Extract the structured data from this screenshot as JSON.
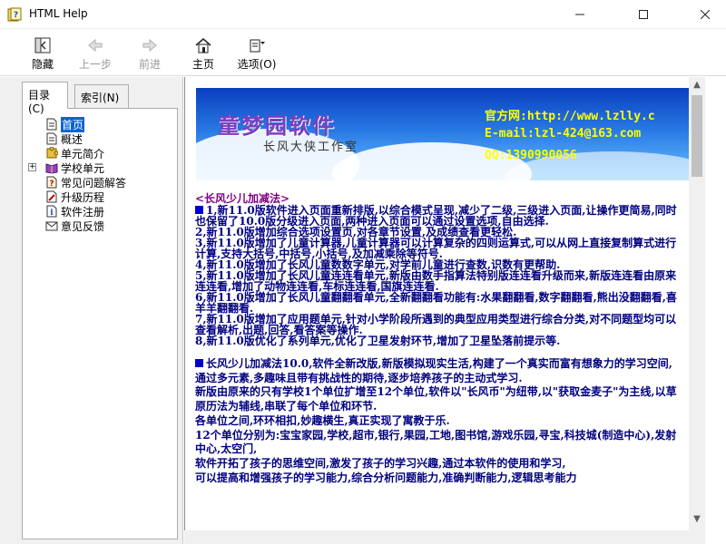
{
  "window": {
    "title": "HTML Help"
  },
  "toolbar": {
    "hide": "隐藏",
    "back": "上一步",
    "forward": "前进",
    "home": "主页",
    "options": "选项(O)"
  },
  "tabs": {
    "contents": "目录(C)",
    "index": "索引(N)"
  },
  "tree": {
    "items": [
      {
        "label": "首页",
        "icon": "page-icon",
        "selected": true
      },
      {
        "label": "概述",
        "icon": "page-icon"
      },
      {
        "label": "单元简介",
        "icon": "puzzle-icon"
      },
      {
        "label": "学校单元",
        "icon": "book-icon",
        "expandable": true
      },
      {
        "label": "常见问题解答",
        "icon": "help-page-icon"
      },
      {
        "label": "升级历程",
        "icon": "pencil-page-icon"
      },
      {
        "label": "软件注册",
        "icon": "info-page-icon"
      },
      {
        "label": "意见反馈",
        "icon": "mail-icon"
      }
    ]
  },
  "banner": {
    "title": "童梦园软件",
    "subtitle": "长风大侠工作室",
    "website": "官方网:http://www.lzlly.c",
    "email": "E-mail:lzl-424@163.com",
    "qq": "QQ:1390990056"
  },
  "content": {
    "heading": "<长风少儿加减法>",
    "updates": [
      "1,新11.0版软件进入页面重新排版,以综合模式呈现,减少了二级,三级进入页面,让操作更简易,同时也保留了10.0版分级进入页面,两种进入页面可以通过设置选项,自由选择.",
      "2,新11.0版增加综合选项设置页,对各章节设置,及成绩查看更轻松.",
      "3,新11.0版增加了儿童计算器,儿童计算器可以计算复杂的四则运算式,可以从网上直接复制算式进行计算,支持大括号,中括号,小括号,及加减乘除等符号.",
      "4,新11.0版增加了长风儿童数数字单元,对学前儿童进行查数,识数有更帮助.",
      "5,新11.0版增加了长风儿童连连看单元,新版由数手指算法特别版连连看升级而来,新版连连看由原来连连看,增加了动物连连看,车标连连看,国旗连连看.",
      "6,新11.0版增加了长风儿童翻翻看单元,全新翻翻看功能有:水果翻翻看,数字翻翻看,熊出没翻翻看,喜羊羊翻翻看.",
      "7,新11.0版增加了应用题单元,针对小学阶段所遇到的典型应用类型进行综合分类,对不同题型均可以查看解析,出题,回答,看答案等操作.",
      "8,新11.0版优化了系列单元,优化了卫星发射环节,增加了卫星坠落前提示等."
    ],
    "paragraphs": [
      "长风少儿加减法10.0,软件全新改版,新版模拟现实生活,构建了一个真实而富有想象力的学习空间,",
      "通过多元素,多趣味且带有挑战性的期待,逐步培养孩子的主动式学习.",
      "新版由原来的只有学校1个单位扩增至12个单位,软件以\"长风币\"为纽带,以\"获取金麦子\"为主线,以草原历法为辅线,串联了每个单位和环节.",
      "各单位之间,环环相扣,妙趣横生,真正实现了寓教于乐.",
      "12个单位分别为:宝宝家园,学校,超市,银行,果园,工地,图书馆,游戏乐园,寻宝,科技城(制造中心),发射中心,太空门,",
      "软件开拓了孩子的思维空间,激发了孩子的学习兴趣,通过本软件的使用和学习,",
      "可以提高和增强孩子的学习能力,综合分析问题能力,准确判断能力,逻辑思考能力"
    ]
  }
}
